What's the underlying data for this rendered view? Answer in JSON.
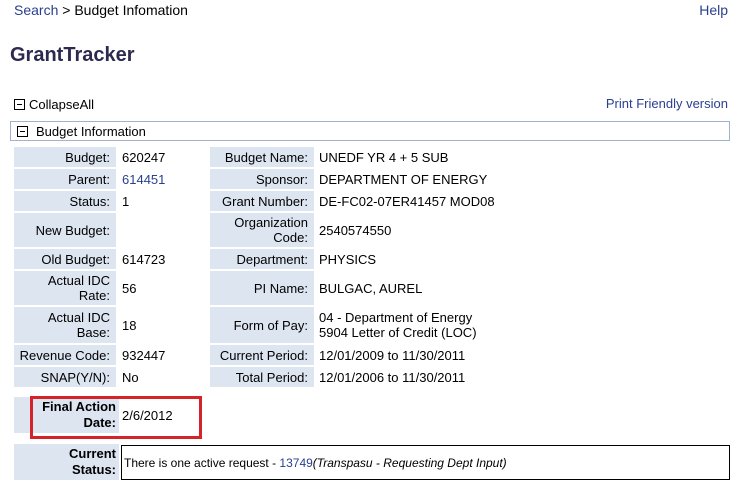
{
  "breadcrumb": {
    "search": "Search",
    "separator": ">",
    "current": "Budget Infomation"
  },
  "help": "Help",
  "app_title": "GrantTracker",
  "collapse_all": "CollapseAll",
  "print_friendly": "Print Friendly version",
  "section_title": "Budget Information",
  "left_fields": [
    {
      "label": "Budget:",
      "value": "620247"
    },
    {
      "label": "Parent:",
      "value": "614451",
      "link": true
    },
    {
      "label": "Status:",
      "value": "1"
    },
    {
      "label": "New Budget:",
      "value": ""
    },
    {
      "label": "Old Budget:",
      "value": "614723"
    },
    {
      "label_line1": "Actual IDC",
      "label_line2": "Rate:",
      "value": "56"
    },
    {
      "label_line1": "Actual IDC",
      "label_line2": "Base:",
      "value": "18"
    },
    {
      "label": "Revenue Code:",
      "value": "932447"
    },
    {
      "label": "SNAP(Y/N):",
      "value": "No"
    }
  ],
  "right_fields": [
    {
      "label": "Budget Name:",
      "value": "UNEDF YR 4 + 5 SUB"
    },
    {
      "label": "Sponsor:",
      "value": "DEPARTMENT OF ENERGY"
    },
    {
      "label": "Grant Number:",
      "value": "DE-FC02-07ER41457 MOD08"
    },
    {
      "label_line1": "Organization",
      "label_line2": "Code:",
      "value": "2540574550"
    },
    {
      "label": "Department:",
      "value": "PHYSICS"
    },
    {
      "label": "PI Name:",
      "value": "BULGAC, AUREL"
    },
    {
      "label": "Form of Pay:",
      "value_line1": "04 - Department of Energy",
      "value_line2": "5904 Letter of Credit (LOC)"
    },
    {
      "label": "Current Period:",
      "value": "12/01/2009 to 11/30/2011"
    },
    {
      "label": "Total Period:",
      "value": "12/01/2006 to 11/30/2011"
    }
  ],
  "final_action": {
    "label_line1": "Final Action",
    "label_line2": "Date:",
    "value": "2/6/2012"
  },
  "current_status": {
    "label_line1": "Current",
    "label_line2": "Status:",
    "prefix": "There is one active request - ",
    "request_id": "13749",
    "detail": "(Transpasu - Requesting Dept Input)"
  },
  "colors": {
    "label_bg": "#dde5f1",
    "link": "#2a3f8f",
    "title": "#2e2a4f",
    "highlight": "#d5232a"
  }
}
